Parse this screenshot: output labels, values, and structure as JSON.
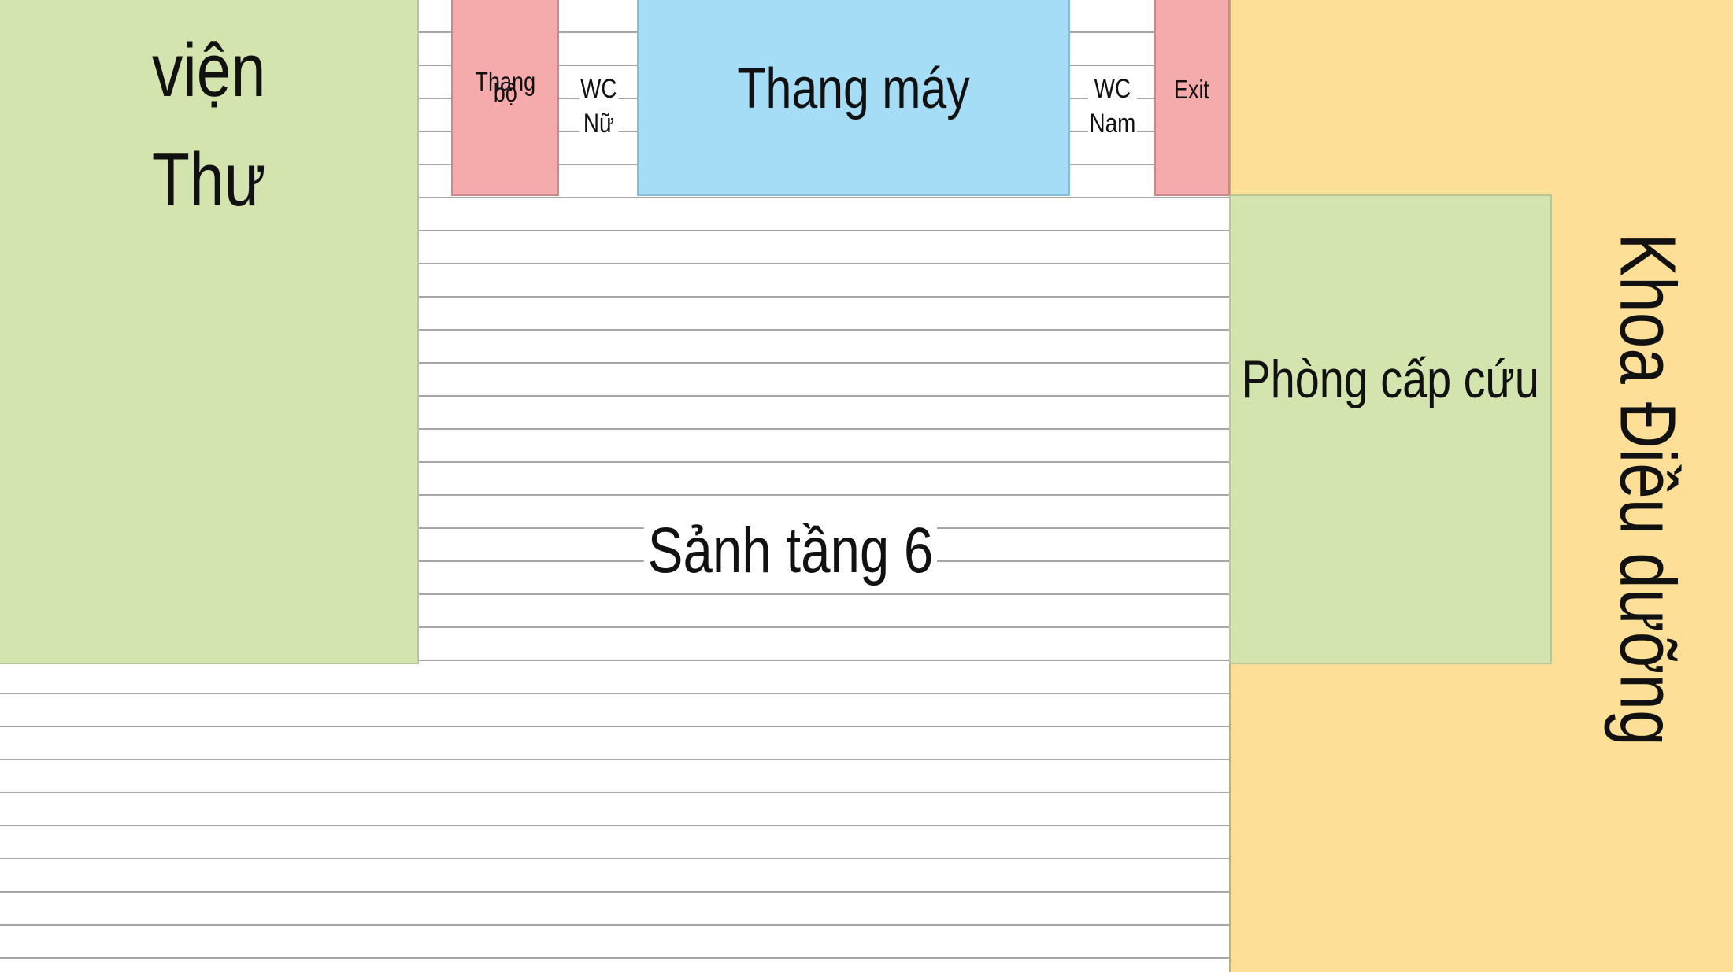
{
  "floor_plan": {
    "library": {
      "line1": "Thư",
      "line2": "viện",
      "color": "#d4e4ae"
    },
    "stairs": {
      "line1": "Thang",
      "line2": "bộ",
      "color": "#f5abab"
    },
    "wc_female": {
      "line1": "WC",
      "line2": "Nữ"
    },
    "elevator": {
      "label": "Thang máy",
      "color": "#a6ddf6"
    },
    "wc_male": {
      "line1": "WC",
      "line2": "Nam"
    },
    "exit": {
      "label": "Exit",
      "color": "#f5abab"
    },
    "emergency_room": {
      "label": "Phòng cấp cứu",
      "color": "#d4e4ae"
    },
    "nursing_department": {
      "label": "Khoa Điều dưỡng",
      "color": "#fddf97"
    },
    "lobby": {
      "label": "Sảnh tầng 6",
      "pattern": "horizontal stripes"
    }
  }
}
